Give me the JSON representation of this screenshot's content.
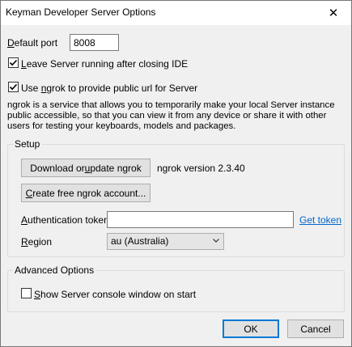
{
  "window": {
    "title": "Keyman Developer Server Options",
    "close_glyph": "✕"
  },
  "general": {
    "default_port_label_prefix": "D",
    "default_port_label_rest": "efault port",
    "default_port_value": "8008",
    "leave_running_prefix": "L",
    "leave_running_rest": "eave Server running after closing IDE",
    "leave_running_checked": true,
    "use_ngrok_prefix": "Use ",
    "use_ngrok_u": "n",
    "use_ngrok_rest": "grok to provide public url for Server",
    "use_ngrok_checked": true,
    "description_line1": "ngrok is a service that allows you to temporarily make your local Server instance",
    "description_line2": "public accessible, so that you can view it from any device or share it with other",
    "description_line3": "users for testing your keyboards, models and packages."
  },
  "setup": {
    "group_label": "Setup",
    "download_btn_prefix": "Download or ",
    "download_btn_u": "u",
    "download_btn_rest": "pdate ngrok",
    "ngrok_version": "ngrok version 2.3.40",
    "create_account_prefix": "C",
    "create_account_rest": "reate free ngrok account...",
    "auth_token_u": "A",
    "auth_token_rest": "uthentication token",
    "auth_token_value": "",
    "get_token_link": "Get token",
    "region_u": "R",
    "region_rest": "egion",
    "region_value": "au (Australia)"
  },
  "advanced": {
    "group_label": "Advanced Options",
    "show_console_u": "S",
    "show_console_rest": "how Server console window on start",
    "show_console_checked": false
  },
  "footer": {
    "ok_label": "OK",
    "cancel_label": "Cancel"
  },
  "colors": {
    "dialog_bg": "#f0f0f0",
    "link": "#0066cc",
    "default_button_border": "#0078d7"
  }
}
